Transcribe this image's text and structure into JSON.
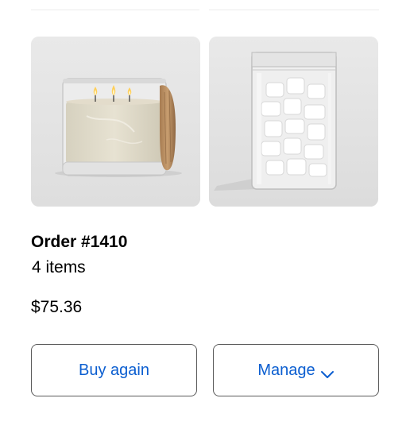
{
  "order": {
    "title": "Order #1410",
    "items_count": "4 items",
    "total": "$75.36"
  },
  "products": [
    {
      "icon": "candle-jar-image"
    },
    {
      "icon": "marshmallow-bag-image"
    }
  ],
  "actions": {
    "buy_again_label": "Buy again",
    "manage_label": "Manage",
    "manage_icon": "chevron-down-icon"
  },
  "colors": {
    "accent": "#0b5ed0",
    "border": "#5a5a5a",
    "thumb_bg": "#e6e6e6"
  }
}
